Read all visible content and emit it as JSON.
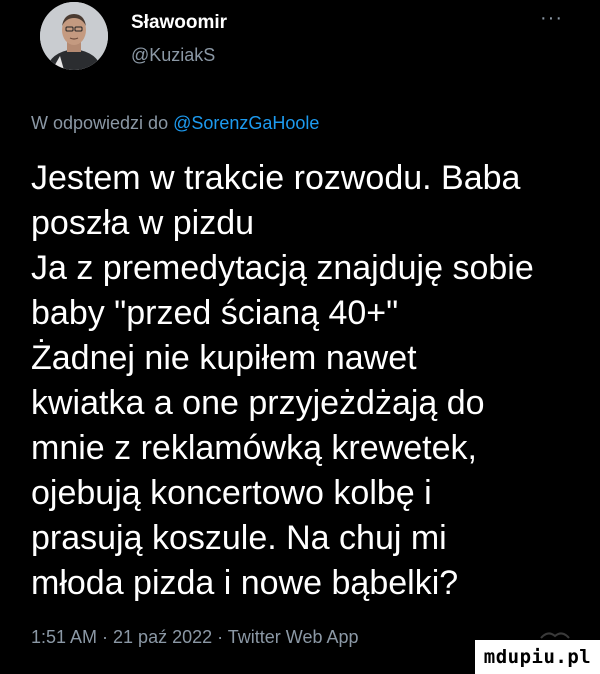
{
  "author": {
    "display_name": "Sławoomir",
    "handle": "@KuziakS",
    "avatar_icon": "user-avatar-photo"
  },
  "more_icon": "ellipsis-icon",
  "more_glyph": "···",
  "reply": {
    "prefix": "W odpowiedzi do ",
    "mention": "@SorenzGaHoole"
  },
  "tweet_text": "Jestem w trakcie rozwodu. Baba\nposzła w pizdu\nJa z premedytacją znajduję sobie\nbaby \"przed ścianą 40+\"\nŻadnej nie kupiłem nawet\nkwiatka a one przyjeżdżają do\nmnie z reklamówką krewetek,\nojebują koncertowo kolbę i\nprasują koszule. Na chuj mi\nmłoda pizda i nowe bąbelki?",
  "meta": "1:51 AM · 21 paź 2022 · Twitter Web App",
  "watermark": "mdupiu.pl",
  "colors": {
    "background": "#000000",
    "text": "#ffffff",
    "secondary": "#8b98a5",
    "link": "#1d9bf0"
  }
}
